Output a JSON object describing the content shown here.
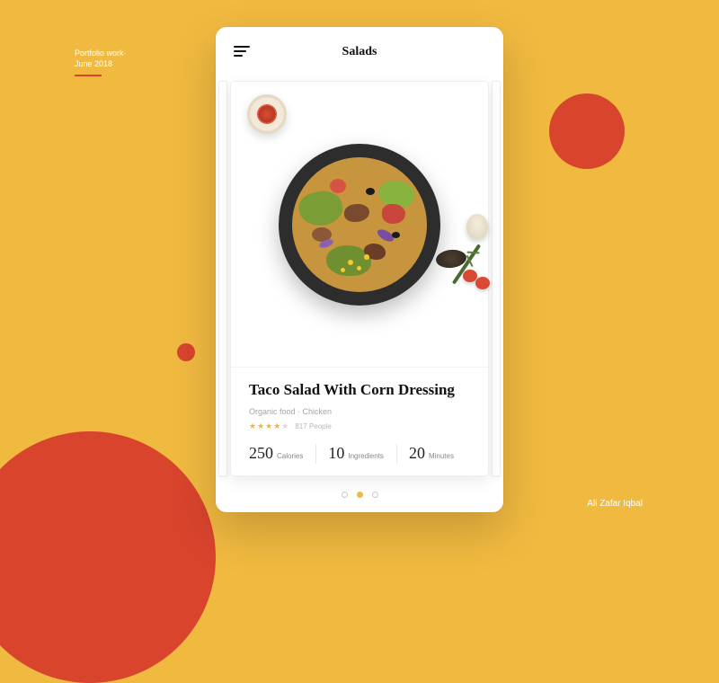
{
  "portfolio": {
    "line1": "Portfolio work·",
    "line2": "June 2018"
  },
  "credit": "Ali Zafar Iqbal",
  "header": {
    "title": "Salads"
  },
  "recipe": {
    "title": "Taco Salad With Corn Dressing",
    "subtitle": "Organic food · Chicken",
    "rating_count": "817 People",
    "rating_value": 4,
    "rating_max": 5
  },
  "stats": [
    {
      "value": "250",
      "label": "Calories"
    },
    {
      "value": "10",
      "label": "Ingredients"
    },
    {
      "value": "20",
      "label": "Minutes"
    }
  ],
  "pager": {
    "count": 3,
    "active": 1
  },
  "colors": {
    "bg": "#f0b940",
    "accent": "#d9442d"
  }
}
